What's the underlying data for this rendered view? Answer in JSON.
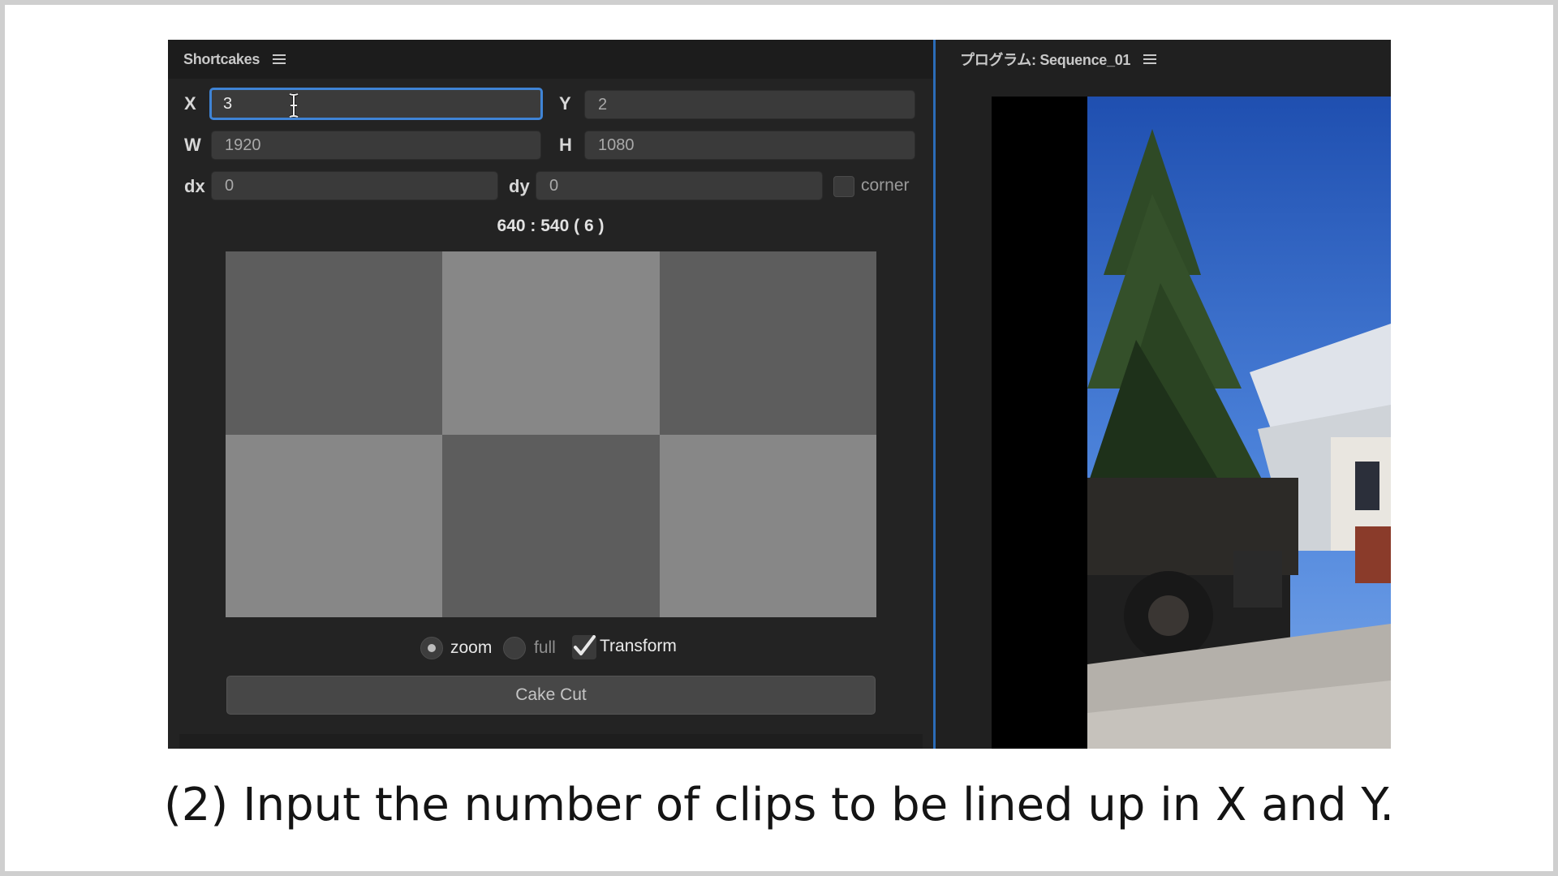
{
  "left_panel": {
    "title": "Shortcakes",
    "menu_icon": "hamburger-menu-icon",
    "fields": {
      "x_label": "X",
      "x_value": "3",
      "y_label": "Y",
      "y_value": "2",
      "w_label": "W",
      "w_value": "1920",
      "h_label": "H",
      "h_value": "1080",
      "dx_label": "dx",
      "dx_value": "0",
      "dy_label": "dy",
      "dy_value": "0"
    },
    "corner_label": "corner",
    "ratio_text": "640 : 540 ( 6 )",
    "preview_grid": {
      "rows": 2,
      "cols": 3,
      "cells": [
        "dark",
        "light",
        "dark",
        "light",
        "dark",
        "light"
      ]
    },
    "options": {
      "zoom_label": "zoom",
      "zoom_selected": true,
      "full_label": "full",
      "full_selected": false,
      "transform_label": "Transform",
      "transform_checked": true
    },
    "button_label": "Cake Cut"
  },
  "right_panel": {
    "title": "プログラム: Sequence_01",
    "menu_icon": "hamburger-menu-icon"
  },
  "caption": "(2) Input the number of clips to be lined up in X and Y.",
  "colors": {
    "focus_accent": "#3f84d6",
    "divider": "#2b6cb8",
    "panel_bg": "#232323"
  }
}
